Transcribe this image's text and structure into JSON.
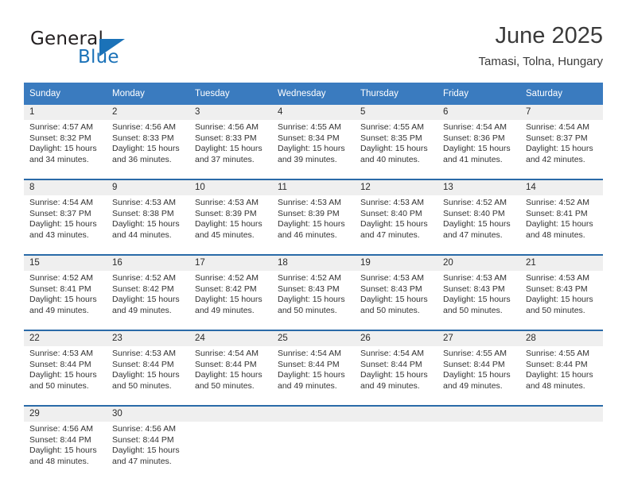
{
  "brand": {
    "line1": "General",
    "line2": "Blue",
    "triangle_icon": "blue-triangle-logo",
    "accent_color": "#1b72b8"
  },
  "header": {
    "title": "June 2025",
    "subtitle": "Tamasi, Tolna, Hungary"
  },
  "calendar": {
    "header_bg": "#3a7bbf",
    "daynum_bg": "#efefef",
    "row_border_color": "#2a6aa8",
    "weekdays": [
      "Sunday",
      "Monday",
      "Tuesday",
      "Wednesday",
      "Thursday",
      "Friday",
      "Saturday"
    ],
    "weeks": [
      {
        "days": [
          {
            "num": "1",
            "sunrise": "Sunrise: 4:57 AM",
            "sunset": "Sunset: 8:32 PM",
            "daylight1": "Daylight: 15 hours",
            "daylight2": "and 34 minutes."
          },
          {
            "num": "2",
            "sunrise": "Sunrise: 4:56 AM",
            "sunset": "Sunset: 8:33 PM",
            "daylight1": "Daylight: 15 hours",
            "daylight2": "and 36 minutes."
          },
          {
            "num": "3",
            "sunrise": "Sunrise: 4:56 AM",
            "sunset": "Sunset: 8:33 PM",
            "daylight1": "Daylight: 15 hours",
            "daylight2": "and 37 minutes."
          },
          {
            "num": "4",
            "sunrise": "Sunrise: 4:55 AM",
            "sunset": "Sunset: 8:34 PM",
            "daylight1": "Daylight: 15 hours",
            "daylight2": "and 39 minutes."
          },
          {
            "num": "5",
            "sunrise": "Sunrise: 4:55 AM",
            "sunset": "Sunset: 8:35 PM",
            "daylight1": "Daylight: 15 hours",
            "daylight2": "and 40 minutes."
          },
          {
            "num": "6",
            "sunrise": "Sunrise: 4:54 AM",
            "sunset": "Sunset: 8:36 PM",
            "daylight1": "Daylight: 15 hours",
            "daylight2": "and 41 minutes."
          },
          {
            "num": "7",
            "sunrise": "Sunrise: 4:54 AM",
            "sunset": "Sunset: 8:37 PM",
            "daylight1": "Daylight: 15 hours",
            "daylight2": "and 42 minutes."
          }
        ]
      },
      {
        "days": [
          {
            "num": "8",
            "sunrise": "Sunrise: 4:54 AM",
            "sunset": "Sunset: 8:37 PM",
            "daylight1": "Daylight: 15 hours",
            "daylight2": "and 43 minutes."
          },
          {
            "num": "9",
            "sunrise": "Sunrise: 4:53 AM",
            "sunset": "Sunset: 8:38 PM",
            "daylight1": "Daylight: 15 hours",
            "daylight2": "and 44 minutes."
          },
          {
            "num": "10",
            "sunrise": "Sunrise: 4:53 AM",
            "sunset": "Sunset: 8:39 PM",
            "daylight1": "Daylight: 15 hours",
            "daylight2": "and 45 minutes."
          },
          {
            "num": "11",
            "sunrise": "Sunrise: 4:53 AM",
            "sunset": "Sunset: 8:39 PM",
            "daylight1": "Daylight: 15 hours",
            "daylight2": "and 46 minutes."
          },
          {
            "num": "12",
            "sunrise": "Sunrise: 4:53 AM",
            "sunset": "Sunset: 8:40 PM",
            "daylight1": "Daylight: 15 hours",
            "daylight2": "and 47 minutes."
          },
          {
            "num": "13",
            "sunrise": "Sunrise: 4:52 AM",
            "sunset": "Sunset: 8:40 PM",
            "daylight1": "Daylight: 15 hours",
            "daylight2": "and 47 minutes."
          },
          {
            "num": "14",
            "sunrise": "Sunrise: 4:52 AM",
            "sunset": "Sunset: 8:41 PM",
            "daylight1": "Daylight: 15 hours",
            "daylight2": "and 48 minutes."
          }
        ]
      },
      {
        "days": [
          {
            "num": "15",
            "sunrise": "Sunrise: 4:52 AM",
            "sunset": "Sunset: 8:41 PM",
            "daylight1": "Daylight: 15 hours",
            "daylight2": "and 49 minutes."
          },
          {
            "num": "16",
            "sunrise": "Sunrise: 4:52 AM",
            "sunset": "Sunset: 8:42 PM",
            "daylight1": "Daylight: 15 hours",
            "daylight2": "and 49 minutes."
          },
          {
            "num": "17",
            "sunrise": "Sunrise: 4:52 AM",
            "sunset": "Sunset: 8:42 PM",
            "daylight1": "Daylight: 15 hours",
            "daylight2": "and 49 minutes."
          },
          {
            "num": "18",
            "sunrise": "Sunrise: 4:52 AM",
            "sunset": "Sunset: 8:43 PM",
            "daylight1": "Daylight: 15 hours",
            "daylight2": "and 50 minutes."
          },
          {
            "num": "19",
            "sunrise": "Sunrise: 4:53 AM",
            "sunset": "Sunset: 8:43 PM",
            "daylight1": "Daylight: 15 hours",
            "daylight2": "and 50 minutes."
          },
          {
            "num": "20",
            "sunrise": "Sunrise: 4:53 AM",
            "sunset": "Sunset: 8:43 PM",
            "daylight1": "Daylight: 15 hours",
            "daylight2": "and 50 minutes."
          },
          {
            "num": "21",
            "sunrise": "Sunrise: 4:53 AM",
            "sunset": "Sunset: 8:43 PM",
            "daylight1": "Daylight: 15 hours",
            "daylight2": "and 50 minutes."
          }
        ]
      },
      {
        "days": [
          {
            "num": "22",
            "sunrise": "Sunrise: 4:53 AM",
            "sunset": "Sunset: 8:44 PM",
            "daylight1": "Daylight: 15 hours",
            "daylight2": "and 50 minutes."
          },
          {
            "num": "23",
            "sunrise": "Sunrise: 4:53 AM",
            "sunset": "Sunset: 8:44 PM",
            "daylight1": "Daylight: 15 hours",
            "daylight2": "and 50 minutes."
          },
          {
            "num": "24",
            "sunrise": "Sunrise: 4:54 AM",
            "sunset": "Sunset: 8:44 PM",
            "daylight1": "Daylight: 15 hours",
            "daylight2": "and 50 minutes."
          },
          {
            "num": "25",
            "sunrise": "Sunrise: 4:54 AM",
            "sunset": "Sunset: 8:44 PM",
            "daylight1": "Daylight: 15 hours",
            "daylight2": "and 49 minutes."
          },
          {
            "num": "26",
            "sunrise": "Sunrise: 4:54 AM",
            "sunset": "Sunset: 8:44 PM",
            "daylight1": "Daylight: 15 hours",
            "daylight2": "and 49 minutes."
          },
          {
            "num": "27",
            "sunrise": "Sunrise: 4:55 AM",
            "sunset": "Sunset: 8:44 PM",
            "daylight1": "Daylight: 15 hours",
            "daylight2": "and 49 minutes."
          },
          {
            "num": "28",
            "sunrise": "Sunrise: 4:55 AM",
            "sunset": "Sunset: 8:44 PM",
            "daylight1": "Daylight: 15 hours",
            "daylight2": "and 48 minutes."
          }
        ]
      },
      {
        "days": [
          {
            "num": "29",
            "sunrise": "Sunrise: 4:56 AM",
            "sunset": "Sunset: 8:44 PM",
            "daylight1": "Daylight: 15 hours",
            "daylight2": "and 48 minutes."
          },
          {
            "num": "30",
            "sunrise": "Sunrise: 4:56 AM",
            "sunset": "Sunset: 8:44 PM",
            "daylight1": "Daylight: 15 hours",
            "daylight2": "and 47 minutes."
          },
          {
            "num": "",
            "sunrise": "",
            "sunset": "",
            "daylight1": "",
            "daylight2": ""
          },
          {
            "num": "",
            "sunrise": "",
            "sunset": "",
            "daylight1": "",
            "daylight2": ""
          },
          {
            "num": "",
            "sunrise": "",
            "sunset": "",
            "daylight1": "",
            "daylight2": ""
          },
          {
            "num": "",
            "sunrise": "",
            "sunset": "",
            "daylight1": "",
            "daylight2": ""
          },
          {
            "num": "",
            "sunrise": "",
            "sunset": "",
            "daylight1": "",
            "daylight2": ""
          }
        ]
      }
    ]
  }
}
